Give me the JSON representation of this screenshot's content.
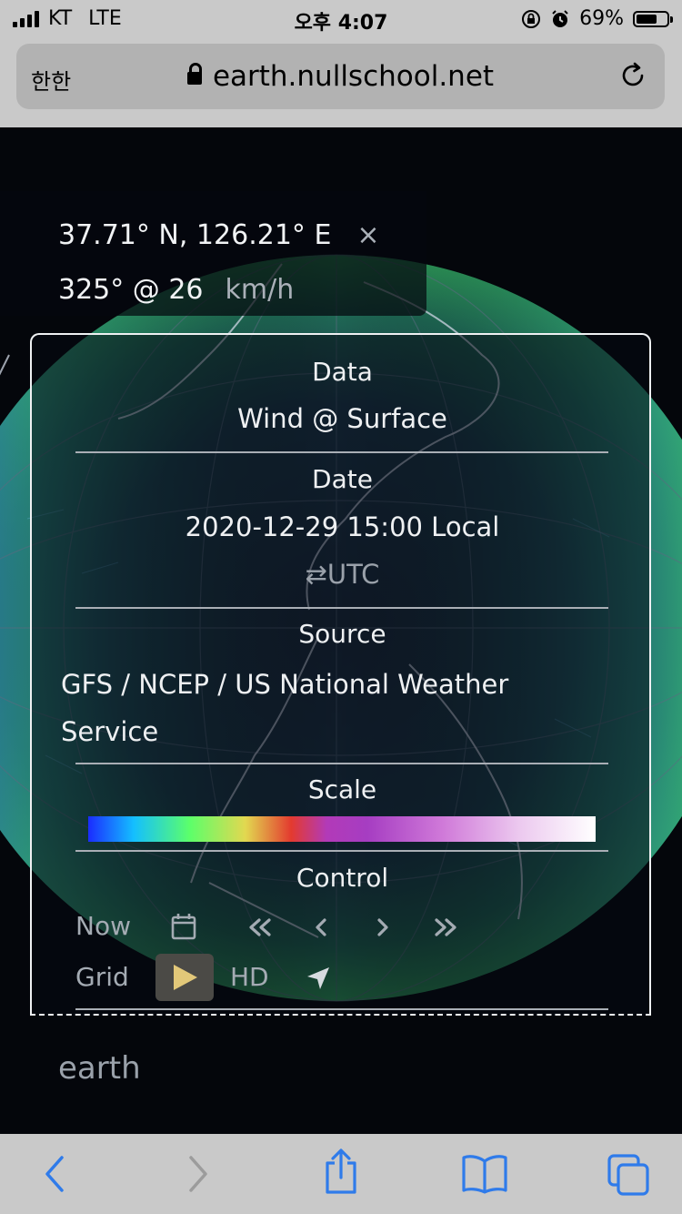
{
  "status_bar": {
    "carrier": "KT",
    "network": "LTE",
    "time": "오후 4:07",
    "battery": "69%",
    "battery_level": 0.69
  },
  "browser": {
    "aa_label": "한한",
    "url": "earth.nullschool.net",
    "reload_icon": "reload-icon",
    "lock_icon": "lock-icon"
  },
  "location": {
    "coordinates": "37.71° N, 126.21° E",
    "close_symbol": "×",
    "wind_value": "325° @ 26",
    "wind_unit": "km/h"
  },
  "panel": {
    "data_title": "Data",
    "data_value": "Wind @ Surface",
    "date_title": "Date",
    "date_value": "2020-12-29 15:00 Local",
    "utc_toggle": "⇄UTC",
    "source_title": "Source",
    "source_value": "GFS / NCEP / US National Weather Service",
    "scale_title": "Scale",
    "control_title": "Control",
    "now_label": "Now",
    "grid_label": "Grid",
    "hd_label": "HD"
  },
  "page": {
    "earth_label": "earth"
  },
  "colors": {
    "accent": "#2f7bea",
    "panel_border": "#eef0f2",
    "scale": [
      "#1b2cff",
      "#14bfff",
      "#5cff6a",
      "#e2d850",
      "#e33a2f",
      "#b23ab8",
      "#d07ad9",
      "#ffffff"
    ]
  },
  "toolbar": {
    "icons": [
      "back-icon",
      "forward-icon",
      "share-icon",
      "bookmarks-icon",
      "tabs-icon"
    ]
  }
}
